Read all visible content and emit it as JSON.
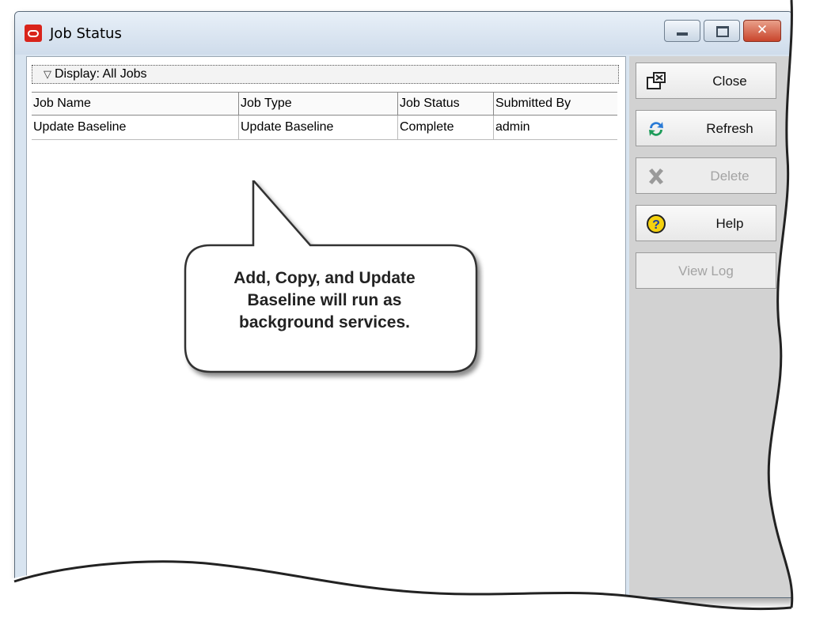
{
  "window": {
    "title": "Job Status"
  },
  "display": {
    "label": "Display: All Jobs"
  },
  "table": {
    "columns": [
      "Job Name",
      "Job Type",
      "Job Status",
      "Submitted By"
    ],
    "rows": [
      [
        "Update Baseline",
        "Update Baseline",
        "Complete",
        "admin"
      ]
    ]
  },
  "callout": {
    "line1": "Add, Copy, and Update",
    "line2": "Baseline will run as",
    "line3": "background services."
  },
  "actions": {
    "close": "Close",
    "refresh": "Refresh",
    "delete": "Delete",
    "help": "Help",
    "view_log": "View Log"
  },
  "icons": {
    "app": "oracle-logo-icon",
    "close": "close-window-icon",
    "refresh": "refresh-icon",
    "delete": "delete-x-icon",
    "help": "help-question-icon"
  },
  "colors": {
    "app_icon": "#d9241b",
    "close_button": "#c9452c",
    "panel": "#d2d2d2"
  }
}
